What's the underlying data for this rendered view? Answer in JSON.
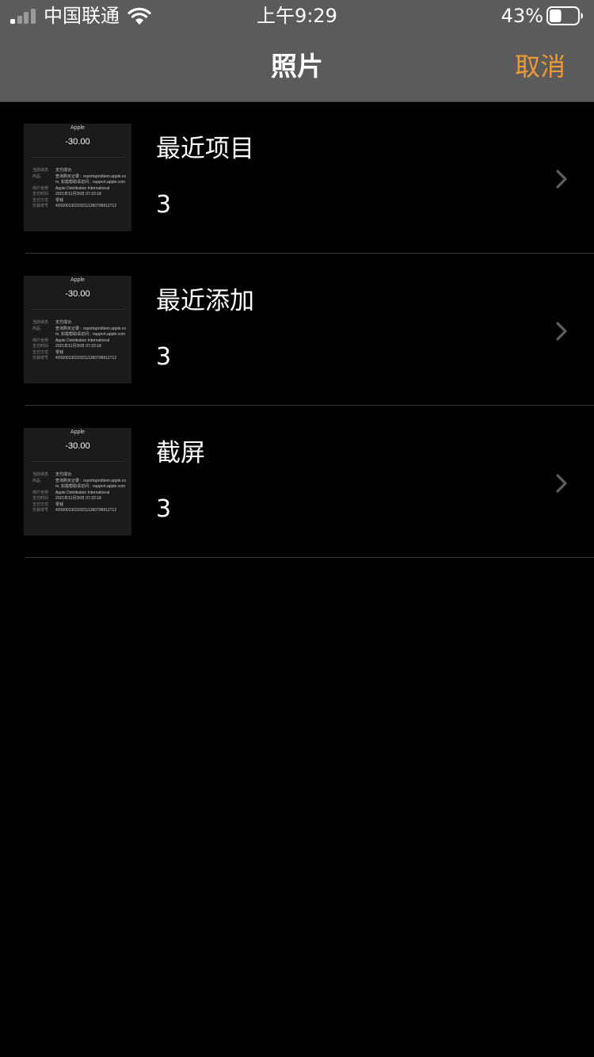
{
  "status_bar": {
    "carrier": "中国联通",
    "time": "上午9:29",
    "battery_percent": "43%",
    "signal_bars_filled": 1,
    "signal_bars_total": 4,
    "battery_level": 0.43
  },
  "nav": {
    "title": "照片",
    "cancel_label": "取消"
  },
  "colors": {
    "accent": "#f09a37",
    "header_bg": "#5b5b5b",
    "background": "#000000"
  },
  "albums": [
    {
      "name": "最近项目",
      "count": "3"
    },
    {
      "name": "最近添加",
      "count": "3"
    },
    {
      "name": "截屏",
      "count": "3"
    }
  ],
  "thumbnail": {
    "merchant": "Apple",
    "amount": "-30.00",
    "rows": [
      {
        "key": "当前状态",
        "value": "支付成功"
      },
      {
        "key": "商品",
        "value": "查询购买记录：reportaproblem.apple.com, 如需帮助请访问：support.apple.com"
      },
      {
        "key": "商户全称",
        "value": "Apple Distribution International"
      },
      {
        "key": "支付时间",
        "value": "2021年11月26日 07:23:18"
      },
      {
        "key": "支付方式",
        "value": "零钱"
      },
      {
        "key": "交易单号",
        "value": "4200001302202111260796912712"
      }
    ]
  },
  "icons": {
    "signal": "cellular-signal-icon",
    "wifi": "wifi-icon",
    "battery": "battery-icon",
    "chevron": "chevron-right-icon"
  }
}
